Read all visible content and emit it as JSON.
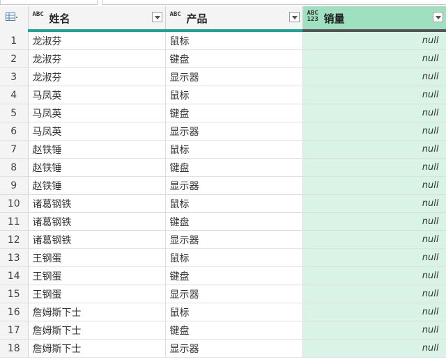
{
  "columns": [
    {
      "label": "姓名",
      "type_icon": "ABC"
    },
    {
      "label": "产品",
      "type_icon": "ABC"
    },
    {
      "label": "销量",
      "type_icon": "ABC 123"
    }
  ],
  "rows": [
    {
      "n": "1",
      "name": "龙淑芬",
      "product": "鼠标",
      "sales": "null"
    },
    {
      "n": "2",
      "name": "龙淑芬",
      "product": "键盘",
      "sales": "null"
    },
    {
      "n": "3",
      "name": "龙淑芬",
      "product": "显示器",
      "sales": "null"
    },
    {
      "n": "4",
      "name": "马凤英",
      "product": "鼠标",
      "sales": "null"
    },
    {
      "n": "5",
      "name": "马凤英",
      "product": "键盘",
      "sales": "null"
    },
    {
      "n": "6",
      "name": "马凤英",
      "product": "显示器",
      "sales": "null"
    },
    {
      "n": "7",
      "name": "赵铁锤",
      "product": "鼠标",
      "sales": "null"
    },
    {
      "n": "8",
      "name": "赵铁锤",
      "product": "键盘",
      "sales": "null"
    },
    {
      "n": "9",
      "name": "赵铁锤",
      "product": "显示器",
      "sales": "null"
    },
    {
      "n": "10",
      "name": "诸葛钢铁",
      "product": "鼠标",
      "sales": "null"
    },
    {
      "n": "11",
      "name": "诸葛钢铁",
      "product": "键盘",
      "sales": "null"
    },
    {
      "n": "12",
      "name": "诸葛钢铁",
      "product": "显示器",
      "sales": "null"
    },
    {
      "n": "13",
      "name": "王钢蛋",
      "product": "鼠标",
      "sales": "null"
    },
    {
      "n": "14",
      "name": "王钢蛋",
      "product": "键盘",
      "sales": "null"
    },
    {
      "n": "15",
      "name": "王钢蛋",
      "product": "显示器",
      "sales": "null"
    },
    {
      "n": "16",
      "name": "詹姆斯下士",
      "product": "鼠标",
      "sales": "null"
    },
    {
      "n": "17",
      "name": "詹姆斯下士",
      "product": "键盘",
      "sales": "null"
    },
    {
      "n": "18",
      "name": "詹姆斯下士",
      "product": "显示器",
      "sales": "null"
    }
  ],
  "colors": {
    "accent": "#1aa59a",
    "selected_header": "#9fe0c0",
    "selected_cells": "#d9f3e6"
  },
  "icons": {
    "table_menu": "table-menu-icon",
    "dropdown": "chevron-down-icon"
  }
}
